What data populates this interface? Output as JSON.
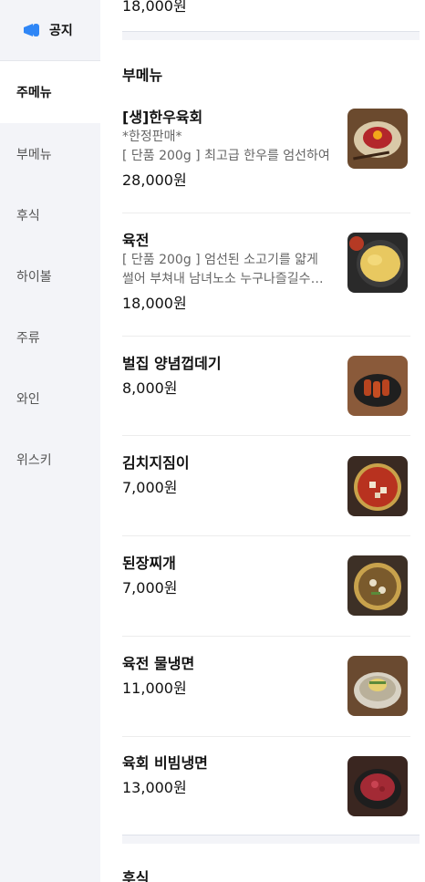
{
  "sidebar": {
    "notice_label": "공지",
    "items": [
      {
        "label": "주메뉴"
      },
      {
        "label": "부메뉴"
      },
      {
        "label": "후식"
      },
      {
        "label": "하이볼"
      },
      {
        "label": "주류"
      },
      {
        "label": "와인"
      },
      {
        "label": "위스키"
      }
    ]
  },
  "main": {
    "prev_price": "18,000원",
    "section_title": "부메뉴",
    "next_section_title": "후식",
    "items": [
      {
        "name": "[생]한우육회",
        "desc1": "*한정판매*",
        "desc2": "[ 단품 200g ] 최고급 한우를 엄선하여",
        "price": "28,000원",
        "icon": "yukhoe-photo"
      },
      {
        "name": "육전",
        "desc1": "[ 단품 200g ] 엄선된 소고기를 얇게",
        "desc2": "썰어 부쳐내 남녀노소 누구나즐길수있는",
        "price": "18,000원",
        "icon": "yukjeon-photo"
      },
      {
        "name": "벌집 양념껍데기",
        "price": "8,000원",
        "icon": "pork-skin-photo"
      },
      {
        "name": "김치지짐이",
        "price": "7,000원",
        "icon": "kimchi-stew-photo"
      },
      {
        "name": "된장찌개",
        "price": "7,000원",
        "icon": "doenjang-stew-photo"
      },
      {
        "name": "육전 물냉면",
        "price": "11,000원",
        "icon": "naengmyeon-photo"
      },
      {
        "name": "육회 비빔냉면",
        "price": "13,000원",
        "icon": "bibim-naengmyeon-photo"
      }
    ]
  }
}
